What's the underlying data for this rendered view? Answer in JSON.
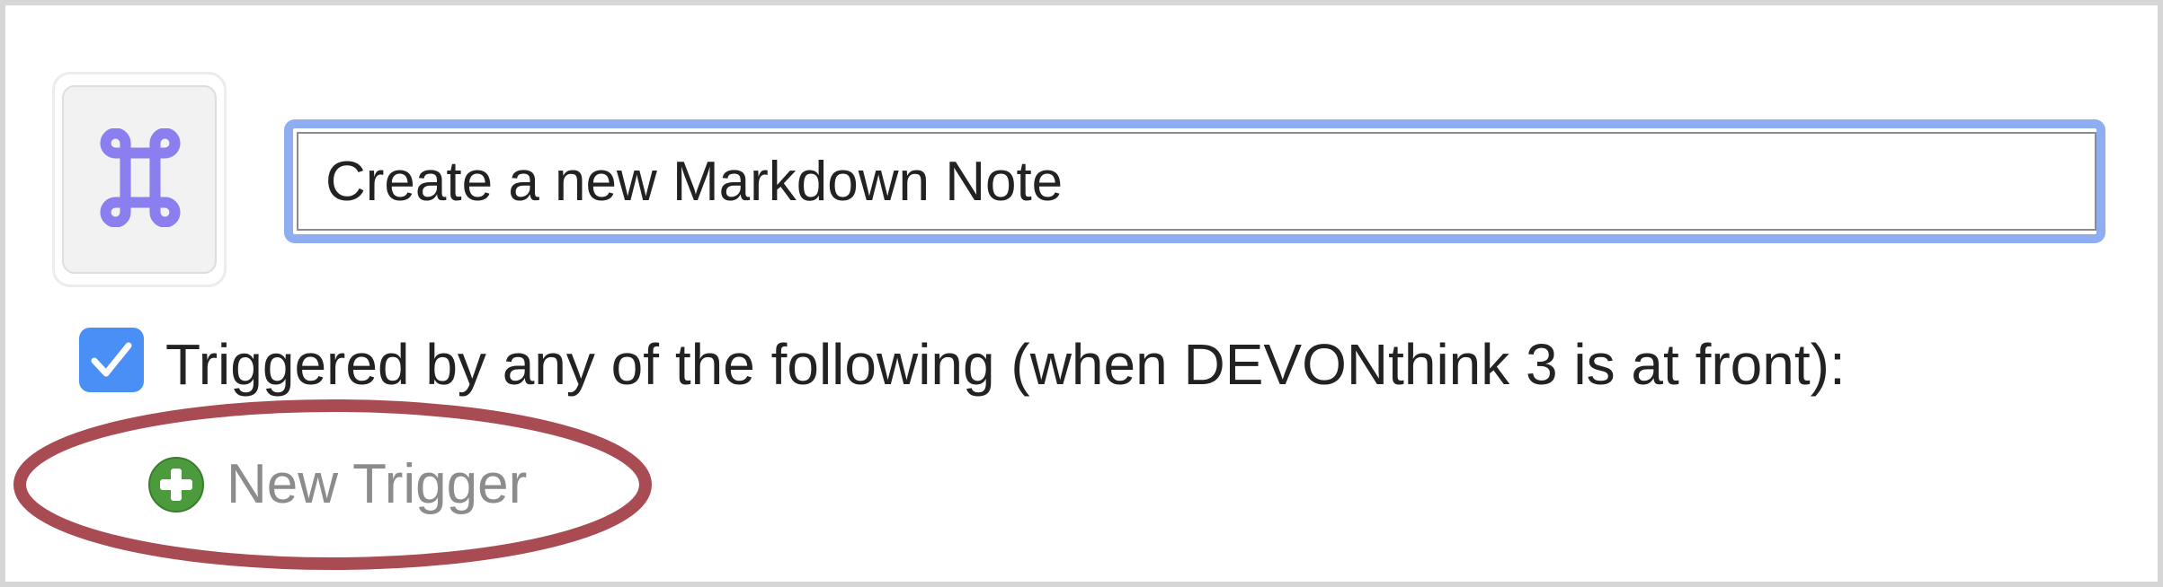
{
  "macro": {
    "icon": "command-key-icon",
    "name_value": "Create a new Markdown Note"
  },
  "triggers": {
    "enabled": true,
    "label": "Triggered by any of the following (when DEVONthink 3 is at front):",
    "new_trigger_label": "New Trigger",
    "new_trigger_icon": "plus-circle-icon"
  },
  "colors": {
    "accent": "#4a8ff6",
    "field_focus": "#8fadf1",
    "command_icon": "#8b7ff0",
    "add_green": "#4b9a3c",
    "highlight_ring": "#a94b52"
  }
}
